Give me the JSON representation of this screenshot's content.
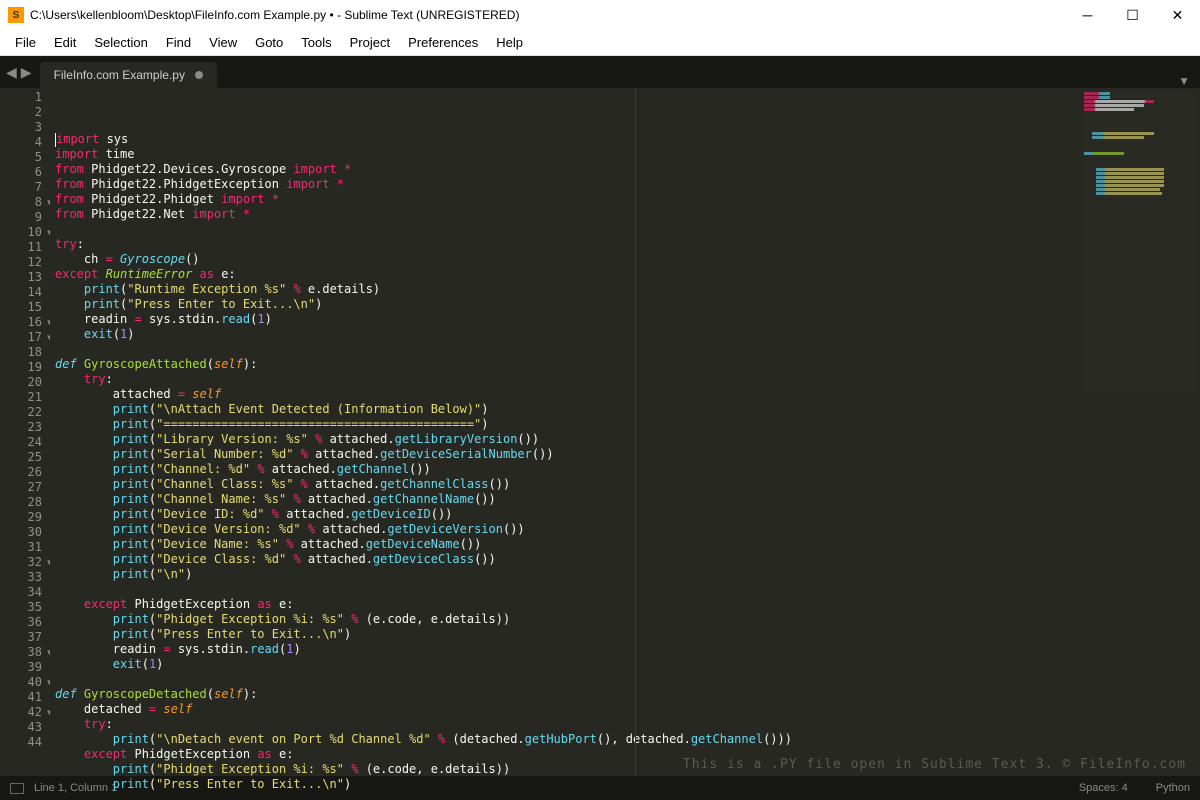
{
  "window": {
    "title": "C:\\Users\\kellenbloom\\Desktop\\FileInfo.com Example.py • - Sublime Text (UNREGISTERED)"
  },
  "menu": {
    "items": [
      "File",
      "Edit",
      "Selection",
      "Find",
      "View",
      "Goto",
      "Tools",
      "Project",
      "Preferences",
      "Help"
    ]
  },
  "tab": {
    "name": "FileInfo.com Example.py"
  },
  "status": {
    "position": "Line 1, Column 1",
    "spaces": "Spaces: 4",
    "lang": "Python"
  },
  "watermark": "This is a .PY file open in Sublime Text 3. © FileInfo.com",
  "code": {
    "lines": [
      {
        "n": 1,
        "fold": false,
        "tokens": [
          [
            "k",
            "import"
          ],
          [
            "n",
            " sys"
          ]
        ]
      },
      {
        "n": 2,
        "fold": false,
        "tokens": [
          [
            "k",
            "import"
          ],
          [
            "n",
            " time"
          ]
        ]
      },
      {
        "n": 3,
        "fold": false,
        "tokens": [
          [
            "k",
            "from"
          ],
          [
            "n",
            " Phidget22.Devices.Gyroscope "
          ],
          [
            "k",
            "import"
          ],
          [
            "n",
            " "
          ],
          [
            "o",
            "*"
          ]
        ]
      },
      {
        "n": 4,
        "fold": false,
        "tokens": [
          [
            "k",
            "from"
          ],
          [
            "n",
            " Phidget22.PhidgetException "
          ],
          [
            "k",
            "import"
          ],
          [
            "n",
            " "
          ],
          [
            "o",
            "*"
          ]
        ]
      },
      {
        "n": 5,
        "fold": false,
        "tokens": [
          [
            "k",
            "from"
          ],
          [
            "n",
            " Phidget22.Phidget "
          ],
          [
            "k",
            "import"
          ],
          [
            "n",
            " "
          ],
          [
            "o",
            "*"
          ]
        ]
      },
      {
        "n": 6,
        "fold": false,
        "tokens": [
          [
            "k",
            "from"
          ],
          [
            "n",
            " Phidget22.Net "
          ],
          [
            "k",
            "import"
          ],
          [
            "n",
            " "
          ],
          [
            "o",
            "*"
          ]
        ]
      },
      {
        "n": 7,
        "fold": false,
        "tokens": []
      },
      {
        "n": 8,
        "fold": true,
        "tokens": [
          [
            "k",
            "try"
          ],
          [
            "n",
            ":"
          ]
        ]
      },
      {
        "n": 9,
        "fold": false,
        "tokens": [
          [
            "n",
            "    ch "
          ],
          [
            "o",
            "="
          ],
          [
            "n",
            " "
          ],
          [
            "bi",
            "Gyroscope"
          ],
          [
            "n",
            "()"
          ]
        ]
      },
      {
        "n": 10,
        "fold": true,
        "tokens": [
          [
            "k",
            "except"
          ],
          [
            "n",
            " "
          ],
          [
            "cls",
            "RuntimeError"
          ],
          [
            "n",
            " "
          ],
          [
            "k",
            "as"
          ],
          [
            "n",
            " e:"
          ]
        ]
      },
      {
        "n": 11,
        "fold": false,
        "tokens": [
          [
            "n",
            "    "
          ],
          [
            "b",
            "print"
          ],
          [
            "n",
            "("
          ],
          [
            "s",
            "\"Runtime Exception %s\""
          ],
          [
            "n",
            " "
          ],
          [
            "o",
            "%"
          ],
          [
            "n",
            " e.details)"
          ]
        ]
      },
      {
        "n": 12,
        "fold": false,
        "tokens": [
          [
            "n",
            "    "
          ],
          [
            "b",
            "print"
          ],
          [
            "n",
            "("
          ],
          [
            "s",
            "\"Press Enter to Exit...\\n\""
          ],
          [
            "n",
            ")"
          ]
        ]
      },
      {
        "n": 13,
        "fold": false,
        "tokens": [
          [
            "n",
            "    readin "
          ],
          [
            "o",
            "="
          ],
          [
            "n",
            " sys.stdin."
          ],
          [
            "b",
            "read"
          ],
          [
            "n",
            "("
          ],
          [
            "num",
            "1"
          ],
          [
            "n",
            ")"
          ]
        ]
      },
      {
        "n": 14,
        "fold": false,
        "tokens": [
          [
            "n",
            "    "
          ],
          [
            "b",
            "exit"
          ],
          [
            "n",
            "("
          ],
          [
            "num",
            "1"
          ],
          [
            "n",
            ")"
          ]
        ]
      },
      {
        "n": 15,
        "fold": false,
        "tokens": []
      },
      {
        "n": 16,
        "fold": true,
        "tokens": [
          [
            "bi",
            "def "
          ],
          [
            "fn",
            "GyroscopeAttached"
          ],
          [
            "n",
            "("
          ],
          [
            "p",
            "self"
          ],
          [
            "n",
            "):"
          ]
        ]
      },
      {
        "n": 17,
        "fold": true,
        "tokens": [
          [
            "n",
            "    "
          ],
          [
            "k",
            "try"
          ],
          [
            "n",
            ":"
          ]
        ]
      },
      {
        "n": 18,
        "fold": false,
        "tokens": [
          [
            "n",
            "        attached "
          ],
          [
            "o",
            "="
          ],
          [
            "n",
            " "
          ],
          [
            "p",
            "self"
          ]
        ]
      },
      {
        "n": 19,
        "fold": false,
        "tokens": [
          [
            "n",
            "        "
          ],
          [
            "b",
            "print"
          ],
          [
            "n",
            "("
          ],
          [
            "s",
            "\"\\nAttach Event Detected (Information Below)\""
          ],
          [
            "n",
            ")"
          ]
        ]
      },
      {
        "n": 20,
        "fold": false,
        "tokens": [
          [
            "n",
            "        "
          ],
          [
            "b",
            "print"
          ],
          [
            "n",
            "("
          ],
          [
            "s",
            "\"===========================================\""
          ],
          [
            "n",
            ")"
          ]
        ]
      },
      {
        "n": 21,
        "fold": false,
        "tokens": [
          [
            "n",
            "        "
          ],
          [
            "b",
            "print"
          ],
          [
            "n",
            "("
          ],
          [
            "s",
            "\"Library Version: %s\""
          ],
          [
            "n",
            " "
          ],
          [
            "o",
            "%"
          ],
          [
            "n",
            " attached."
          ],
          [
            "b",
            "getLibraryVersion"
          ],
          [
            "n",
            "())"
          ]
        ]
      },
      {
        "n": 22,
        "fold": false,
        "tokens": [
          [
            "n",
            "        "
          ],
          [
            "b",
            "print"
          ],
          [
            "n",
            "("
          ],
          [
            "s",
            "\"Serial Number: %d\""
          ],
          [
            "n",
            " "
          ],
          [
            "o",
            "%"
          ],
          [
            "n",
            " attached."
          ],
          [
            "b",
            "getDeviceSerialNumber"
          ],
          [
            "n",
            "())"
          ]
        ]
      },
      {
        "n": 23,
        "fold": false,
        "tokens": [
          [
            "n",
            "        "
          ],
          [
            "b",
            "print"
          ],
          [
            "n",
            "("
          ],
          [
            "s",
            "\"Channel: %d\""
          ],
          [
            "n",
            " "
          ],
          [
            "o",
            "%"
          ],
          [
            "n",
            " attached."
          ],
          [
            "b",
            "getChannel"
          ],
          [
            "n",
            "())"
          ]
        ]
      },
      {
        "n": 24,
        "fold": false,
        "tokens": [
          [
            "n",
            "        "
          ],
          [
            "b",
            "print"
          ],
          [
            "n",
            "("
          ],
          [
            "s",
            "\"Channel Class: %s\""
          ],
          [
            "n",
            " "
          ],
          [
            "o",
            "%"
          ],
          [
            "n",
            " attached."
          ],
          [
            "b",
            "getChannelClass"
          ],
          [
            "n",
            "())"
          ]
        ]
      },
      {
        "n": 25,
        "fold": false,
        "tokens": [
          [
            "n",
            "        "
          ],
          [
            "b",
            "print"
          ],
          [
            "n",
            "("
          ],
          [
            "s",
            "\"Channel Name: %s\""
          ],
          [
            "n",
            " "
          ],
          [
            "o",
            "%"
          ],
          [
            "n",
            " attached."
          ],
          [
            "b",
            "getChannelName"
          ],
          [
            "n",
            "())"
          ]
        ]
      },
      {
        "n": 26,
        "fold": false,
        "tokens": [
          [
            "n",
            "        "
          ],
          [
            "b",
            "print"
          ],
          [
            "n",
            "("
          ],
          [
            "s",
            "\"Device ID: %d\""
          ],
          [
            "n",
            " "
          ],
          [
            "o",
            "%"
          ],
          [
            "n",
            " attached."
          ],
          [
            "b",
            "getDeviceID"
          ],
          [
            "n",
            "())"
          ]
        ]
      },
      {
        "n": 27,
        "fold": false,
        "tokens": [
          [
            "n",
            "        "
          ],
          [
            "b",
            "print"
          ],
          [
            "n",
            "("
          ],
          [
            "s",
            "\"Device Version: %d\""
          ],
          [
            "n",
            " "
          ],
          [
            "o",
            "%"
          ],
          [
            "n",
            " attached."
          ],
          [
            "b",
            "getDeviceVersion"
          ],
          [
            "n",
            "())"
          ]
        ]
      },
      {
        "n": 28,
        "fold": false,
        "tokens": [
          [
            "n",
            "        "
          ],
          [
            "b",
            "print"
          ],
          [
            "n",
            "("
          ],
          [
            "s",
            "\"Device Name: %s\""
          ],
          [
            "n",
            " "
          ],
          [
            "o",
            "%"
          ],
          [
            "n",
            " attached."
          ],
          [
            "b",
            "getDeviceName"
          ],
          [
            "n",
            "())"
          ]
        ]
      },
      {
        "n": 29,
        "fold": false,
        "tokens": [
          [
            "n",
            "        "
          ],
          [
            "b",
            "print"
          ],
          [
            "n",
            "("
          ],
          [
            "s",
            "\"Device Class: %d\""
          ],
          [
            "n",
            " "
          ],
          [
            "o",
            "%"
          ],
          [
            "n",
            " attached."
          ],
          [
            "b",
            "getDeviceClass"
          ],
          [
            "n",
            "())"
          ]
        ]
      },
      {
        "n": 30,
        "fold": false,
        "tokens": [
          [
            "n",
            "        "
          ],
          [
            "b",
            "print"
          ],
          [
            "n",
            "("
          ],
          [
            "s",
            "\"\\n\""
          ],
          [
            "n",
            ")"
          ]
        ]
      },
      {
        "n": 31,
        "fold": false,
        "tokens": []
      },
      {
        "n": 32,
        "fold": true,
        "tokens": [
          [
            "n",
            "    "
          ],
          [
            "k",
            "except"
          ],
          [
            "n",
            " PhidgetException "
          ],
          [
            "k",
            "as"
          ],
          [
            "n",
            " e:"
          ]
        ]
      },
      {
        "n": 33,
        "fold": false,
        "tokens": [
          [
            "n",
            "        "
          ],
          [
            "b",
            "print"
          ],
          [
            "n",
            "("
          ],
          [
            "s",
            "\"Phidget Exception %i: %s\""
          ],
          [
            "n",
            " "
          ],
          [
            "o",
            "%"
          ],
          [
            "n",
            " (e.code, e.details))"
          ]
        ]
      },
      {
        "n": 34,
        "fold": false,
        "tokens": [
          [
            "n",
            "        "
          ],
          [
            "b",
            "print"
          ],
          [
            "n",
            "("
          ],
          [
            "s",
            "\"Press Enter to Exit...\\n\""
          ],
          [
            "n",
            ")"
          ]
        ]
      },
      {
        "n": 35,
        "fold": false,
        "tokens": [
          [
            "n",
            "        readin "
          ],
          [
            "o",
            "="
          ],
          [
            "n",
            " sys.stdin."
          ],
          [
            "b",
            "read"
          ],
          [
            "n",
            "("
          ],
          [
            "num",
            "1"
          ],
          [
            "n",
            ")"
          ]
        ]
      },
      {
        "n": 36,
        "fold": false,
        "tokens": [
          [
            "n",
            "        "
          ],
          [
            "b",
            "exit"
          ],
          [
            "n",
            "("
          ],
          [
            "num",
            "1"
          ],
          [
            "n",
            ")"
          ]
        ]
      },
      {
        "n": 37,
        "fold": false,
        "tokens": []
      },
      {
        "n": 38,
        "fold": true,
        "tokens": [
          [
            "bi",
            "def "
          ],
          [
            "fn",
            "GyroscopeDetached"
          ],
          [
            "n",
            "("
          ],
          [
            "p",
            "self"
          ],
          [
            "n",
            "):"
          ]
        ]
      },
      {
        "n": 39,
        "fold": false,
        "tokens": [
          [
            "n",
            "    detached "
          ],
          [
            "o",
            "="
          ],
          [
            "n",
            " "
          ],
          [
            "p",
            "self"
          ]
        ]
      },
      {
        "n": 40,
        "fold": true,
        "tokens": [
          [
            "n",
            "    "
          ],
          [
            "k",
            "try"
          ],
          [
            "n",
            ":"
          ]
        ]
      },
      {
        "n": 41,
        "fold": false,
        "tokens": [
          [
            "n",
            "        "
          ],
          [
            "b",
            "print"
          ],
          [
            "n",
            "("
          ],
          [
            "s",
            "\"\\nDetach event on Port %d Channel %d\""
          ],
          [
            "n",
            " "
          ],
          [
            "o",
            "%"
          ],
          [
            "n",
            " (detached."
          ],
          [
            "b",
            "getHubPort"
          ],
          [
            "n",
            "(), detached."
          ],
          [
            "b",
            "getChannel"
          ],
          [
            "n",
            "()))"
          ]
        ]
      },
      {
        "n": 42,
        "fold": true,
        "tokens": [
          [
            "n",
            "    "
          ],
          [
            "k",
            "except"
          ],
          [
            "n",
            " PhidgetException "
          ],
          [
            "k",
            "as"
          ],
          [
            "n",
            " e:"
          ]
        ]
      },
      {
        "n": 43,
        "fold": false,
        "tokens": [
          [
            "n",
            "        "
          ],
          [
            "b",
            "print"
          ],
          [
            "n",
            "("
          ],
          [
            "s",
            "\"Phidget Exception %i: %s\""
          ],
          [
            "n",
            " "
          ],
          [
            "o",
            "%"
          ],
          [
            "n",
            " (e.code, e.details))"
          ]
        ]
      },
      {
        "n": 44,
        "fold": false,
        "tokens": [
          [
            "n",
            "        "
          ],
          [
            "b",
            "print"
          ],
          [
            "n",
            "("
          ],
          [
            "s",
            "\"Press Enter to Exit...\\n\""
          ],
          [
            "n",
            ")"
          ]
        ]
      }
    ]
  }
}
